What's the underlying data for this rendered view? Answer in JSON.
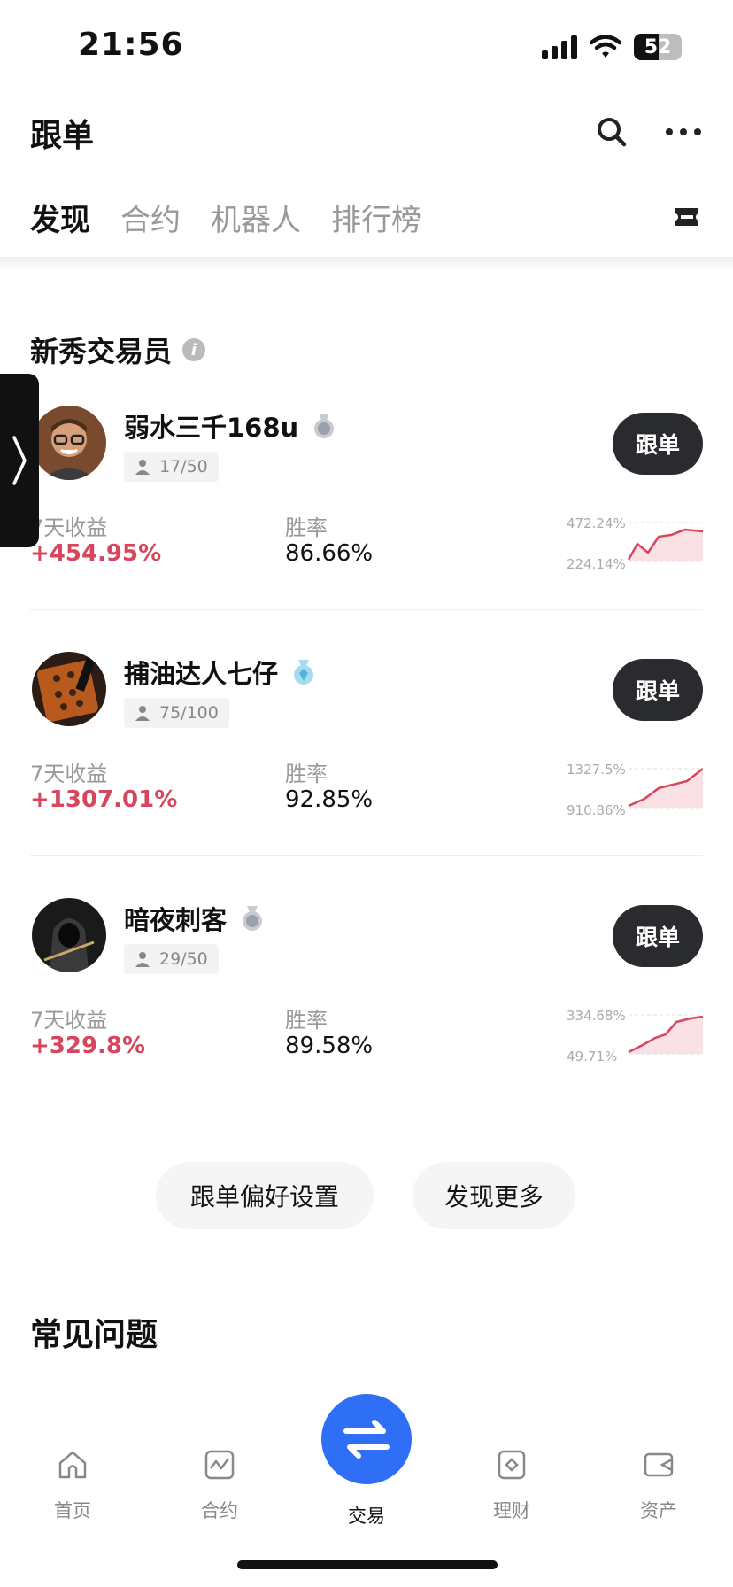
{
  "status_bar": {
    "time": "21:56",
    "battery": "52"
  },
  "header": {
    "title": "跟单"
  },
  "tabs": [
    {
      "label": "发现",
      "active": true
    },
    {
      "label": "合约",
      "active": false
    },
    {
      "label": "机器人",
      "active": false
    },
    {
      "label": "排行榜",
      "active": false
    }
  ],
  "section": {
    "title": "新秀交易员"
  },
  "traders": [
    {
      "name": "弱水三千168u",
      "followers": "17/50",
      "follow_label": "跟单",
      "pnl_label": "7天收益",
      "pnl": "+454.95%",
      "win_label": "胜率",
      "win": "86.66%",
      "spark_top": "472.24%",
      "spark_bottom": "224.14%",
      "badge": "silver-medal-icon"
    },
    {
      "name": "捕油达人七仔",
      "followers": "75/100",
      "follow_label": "跟单",
      "pnl_label": "7天收益",
      "pnl": "+1307.01%",
      "win_label": "胜率",
      "win": "92.85%",
      "spark_top": "1327.5%",
      "spark_bottom": "910.86%",
      "badge": "blue-medal-icon"
    },
    {
      "name": "暗夜刺客",
      "followers": "29/50",
      "follow_label": "跟单",
      "pnl_label": "7天收益",
      "pnl": "+329.8%",
      "win_label": "胜率",
      "win": "89.58%",
      "spark_top": "334.68%",
      "spark_bottom": "49.71%",
      "badge": "silver-medal-icon"
    }
  ],
  "actions": {
    "preferences": "跟单偏好设置",
    "discover_more": "发现更多"
  },
  "faq": {
    "title": "常见问题"
  },
  "bottom_nav": [
    {
      "label": "首页",
      "icon": "home-icon"
    },
    {
      "label": "合约",
      "icon": "contract-chart-icon"
    },
    {
      "label": "交易",
      "icon": "swap-arrows-icon"
    },
    {
      "label": "理财",
      "icon": "finance-icon"
    },
    {
      "label": "资产",
      "icon": "wallet-icon"
    }
  ],
  "colors": {
    "accent": "#2f6ff5",
    "profit": "#d6475d",
    "button_dark": "#2a2b2e"
  }
}
